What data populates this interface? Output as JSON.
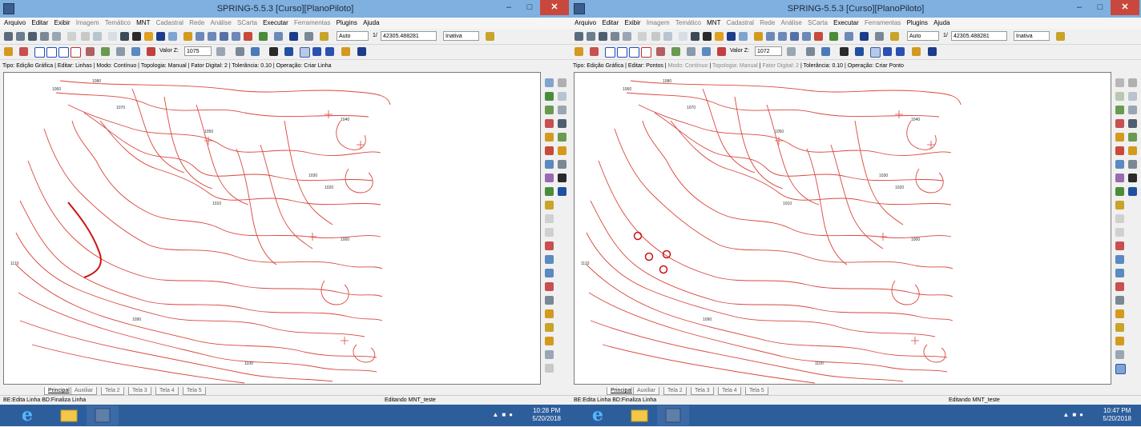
{
  "window": {
    "title": "SPRING-5.5.3 [Curso][PlanoPiloto]",
    "minimize": "–",
    "maximize": "□",
    "close": "✕",
    "menu": [
      {
        "label": "Arquivo",
        "enabled": true
      },
      {
        "label": "Editar",
        "enabled": true
      },
      {
        "label": "Exibir",
        "enabled": true
      },
      {
        "label": "Imagem",
        "enabled": false
      },
      {
        "label": "Temático",
        "enabled": false
      },
      {
        "label": "MNT",
        "enabled": true
      },
      {
        "label": "Cadastral",
        "enabled": false
      },
      {
        "label": "Rede",
        "enabled": false
      },
      {
        "label": "Análise",
        "enabled": false
      },
      {
        "label": "SCarta",
        "enabled": false
      },
      {
        "label": "Executar",
        "enabled": true
      },
      {
        "label": "Ferramentas",
        "enabled": false
      },
      {
        "label": "Plugins",
        "enabled": true
      },
      {
        "label": "Ajuda",
        "enabled": true
      }
    ],
    "toolbar": {
      "zoom_mode": "Auto",
      "scale_prefix": "1/",
      "scale": "42305.488281",
      "state": "Inativa",
      "valor_z_label": "Valor Z:"
    },
    "tabs": [
      "Principal",
      "Auxiliar",
      "Tela 2",
      "Tela 3",
      "Tela 4",
      "Tela 5"
    ],
    "status_hint": "BE:Edita Linha  BD:Finaliza Linha",
    "status_center": "Editando MNT_teste"
  },
  "left": {
    "valor_z": "1075",
    "infobar": {
      "tipo": "Tipo: Edição Gráfica",
      "editar": "Editar: Linhas",
      "modo": "Modo: Contínuo",
      "topologia": "Topologia: Manual",
      "fator": "Fator Digital: 2",
      "tolerancia": "Tolerância: 0.10",
      "operacao": "Operação: Criar Linha"
    },
    "clock_time": "10:28 PM",
    "clock_date": "5/20/2018"
  },
  "right": {
    "valor_z": "1072",
    "infobar": {
      "tipo": "Tipo: Edição Gráfica",
      "editar": "Editar: Pontos",
      "modo": "Modo: Contínuo",
      "topologia": "Topologia: Manual",
      "fator": "Fator Digital: 2",
      "tolerancia": "Tolerância: 0.10",
      "operacao": "Operação: Criar Ponto"
    },
    "clock_time": "10:47 PM",
    "clock_date": "5/20/2018"
  },
  "map_labels": [
    "1080",
    "1060",
    "1070",
    "1050",
    "1040",
    "1030",
    "1020",
    "1010",
    "1110",
    "1100",
    "1090",
    "1000"
  ],
  "colors": {
    "contour": "#d9473f",
    "highlight": "#cc1111",
    "titlebar": "#7fb0df",
    "taskbar": "#2d5e9c",
    "close_button": "#c9483d"
  },
  "icons": [
    "app-icon",
    "internet-explorer-icon",
    "file-explorer-icon",
    "spring-app-icon"
  ]
}
